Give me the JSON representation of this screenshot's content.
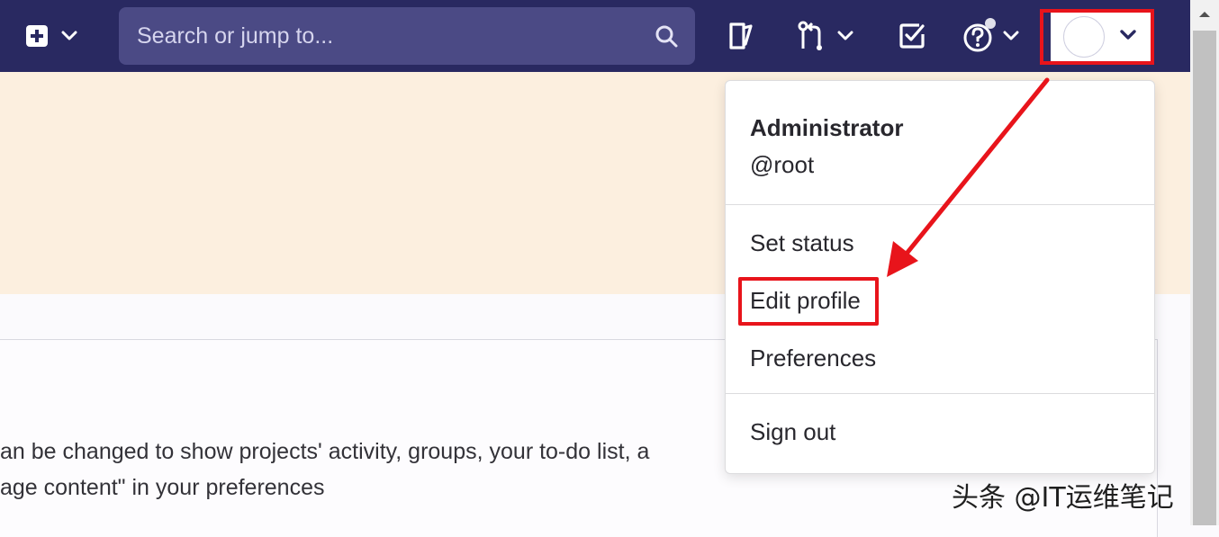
{
  "navbar": {
    "search_placeholder": "Search or jump to...",
    "icons": [
      "plus-square-icon",
      "chevron-down-icon",
      "search-icon",
      "issues-icon",
      "merge-request-icon",
      "todo-icon",
      "help-icon"
    ],
    "colors": {
      "background": "#292961",
      "search_bg": "#4b4a85",
      "highlight": "#e8141b"
    }
  },
  "user_dropdown": {
    "name": "Administrator",
    "username": "@root",
    "items": [
      {
        "label": "Set status"
      },
      {
        "label": "Edit profile"
      },
      {
        "label": "Preferences"
      },
      {
        "label": "Sign out"
      }
    ]
  },
  "page": {
    "text_line_1": "an be changed to show projects' activity, groups, your to-do list, a",
    "text_line_2": "age content\" in your preferences"
  },
  "watermark": "头条 @IT运维笔记"
}
